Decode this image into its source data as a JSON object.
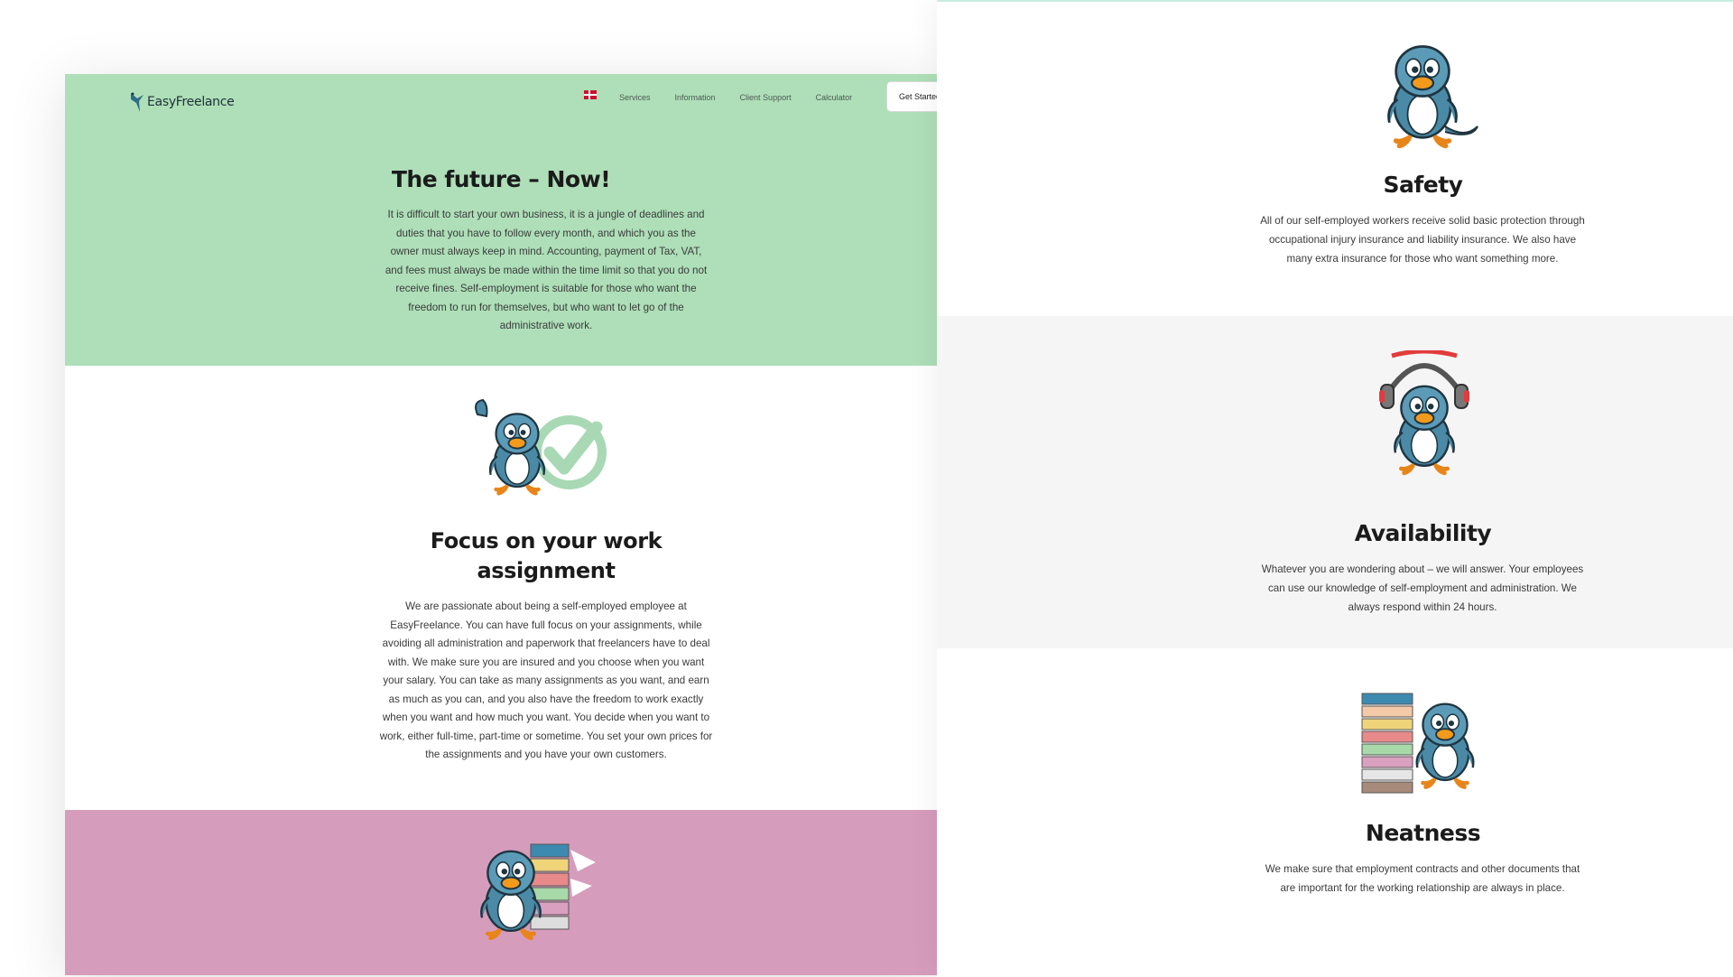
{
  "nav": {
    "logo_text": "EasyFreelance",
    "items": [
      "Services",
      "Information",
      "Client Support",
      "Calculator"
    ],
    "cta_label": "Get Started"
  },
  "hero": {
    "title": "The future – Now!",
    "text": "It is difficult to start your own business, it is a jungle of deadlines and duties that you have to follow every month, and which you as the owner must always keep in mind. Accounting, payment of Tax, VAT, and fees must always be made within the time limit so that you do not receive fines. Self-employment is suitable for those who want the freedom to run for themselves, but who want to let go of the administrative work."
  },
  "focus": {
    "title": "Focus on your work assignment",
    "text": "We are passionate about being a self-employed employee at EasyFreelance. You can have full focus on your assignments, while avoiding all administration and paperwork that freelancers have to deal with. We make sure you are insured and you choose when you want your salary. You can take as many assignments as you want, and earn as much as you can, and you also have the freedom to work exactly when you want and how much you want. You decide when you want to work, either full-time, part-time or sometime. You set your own prices for the assignments and you have your own customers."
  },
  "features": {
    "safety": {
      "title": "Safety",
      "text": "All of our self-employed workers receive solid basic protection through occupational injury insurance and liability insurance. We also have many extra insurance for those who want something more."
    },
    "availability": {
      "title": "Availability",
      "text": "Whatever you are wondering about – we will answer. Your employees can use our knowledge of self-employment and administration. We always respond within 24 hours."
    },
    "neatness": {
      "title": "Neatness",
      "text": "We make sure that employment contracts and other documents that are important for the working relationship are always in place."
    }
  },
  "colors": {
    "hero_bg": "#aedfb8",
    "pink_bg": "#d69cbc",
    "availability_bg": "#f5f5f5",
    "bird_blue": "#4a8aa6",
    "beak_orange": "#f39a1c"
  },
  "icons": [
    "logo-bird-icon",
    "danish-flag-icon",
    "checkmark-icon",
    "headset-icon",
    "binders-icon"
  ]
}
